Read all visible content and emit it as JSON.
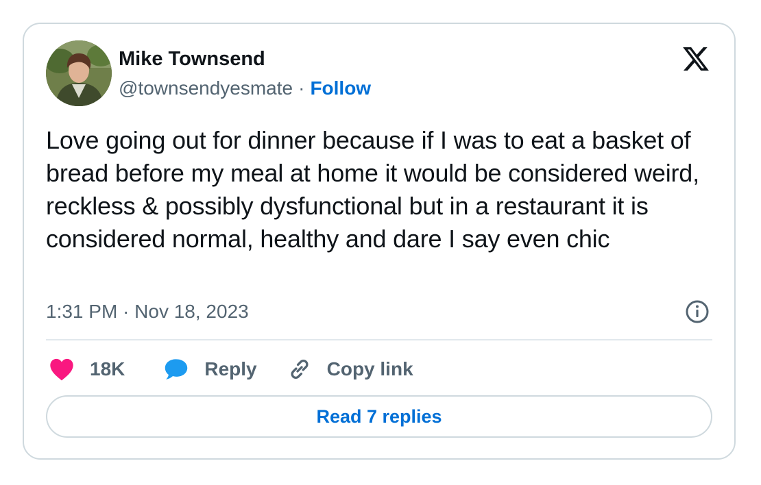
{
  "author": {
    "name": "Mike Townsend",
    "handle": "@townsendyesmate",
    "separator": "·",
    "follow_label": "Follow",
    "avatar_icon": "profile-photo"
  },
  "brand": {
    "logo_icon": "x-logo"
  },
  "tweet": {
    "text": "Love going out for dinner because if I was to eat a basket of bread before my meal at home it would be considered weird, reckless & possibly dysfunctional but in a restaurant it is considered normal, healthy and dare I say even chic",
    "timestamp": "1:31 PM · Nov 18, 2023"
  },
  "actions": {
    "like_count": "18K",
    "like_icon": "heart-icon",
    "reply_label": "Reply",
    "reply_icon": "speech-bubble-icon",
    "copy_label": "Copy link",
    "copy_icon": "link-icon"
  },
  "footer": {
    "read_replies_label": "Read 7 replies"
  },
  "colors": {
    "like": "#f91880",
    "reply": "#1d9bf0",
    "link": "#006fd6",
    "secondary_text": "#536471",
    "border": "#cfd9de"
  }
}
